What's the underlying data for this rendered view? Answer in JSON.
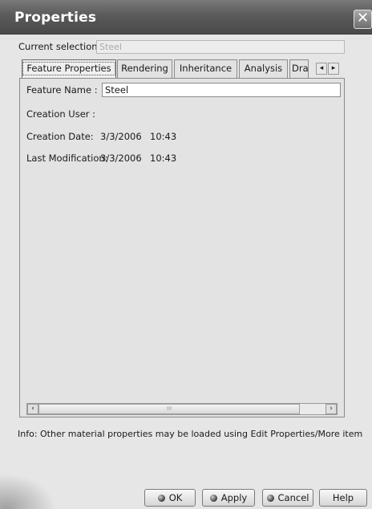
{
  "window": {
    "title": "Properties",
    "close_glyph": "✕"
  },
  "selection": {
    "label": "Current selection :",
    "value": "Steel"
  },
  "tabs": [
    {
      "label": "Feature Properties",
      "active": true
    },
    {
      "label": "Rendering"
    },
    {
      "label": "Inheritance"
    },
    {
      "label": "Analysis"
    },
    {
      "label": "Dra"
    }
  ],
  "tab_scroll": {
    "left_glyph": "◂",
    "right_glyph": "▸"
  },
  "feature": {
    "name_label": "Feature Name :",
    "name_value": "Steel",
    "creation_user_label": "Creation User :",
    "creation_user_value": "",
    "creation_date_label": "Creation Date:",
    "creation_date_value": "3/3/2006",
    "creation_time_value": "10:43",
    "last_mod_label": "Last Modification:",
    "last_mod_date_value": "3/3/2006",
    "last_mod_time_value": "10:43"
  },
  "scrollbar": {
    "left_glyph": "‹",
    "right_glyph": "›",
    "grip": "III"
  },
  "info": "Info: Other material properties may be loaded using Edit Properties/More item",
  "buttons": {
    "ok": "OK",
    "apply": "Apply",
    "cancel": "Cancel",
    "help": "Help"
  },
  "colors": {
    "titlebar": "#5a5a5a",
    "dialog_bg": "#e6e6e6",
    "panel_bg": "#e3e3e3"
  }
}
